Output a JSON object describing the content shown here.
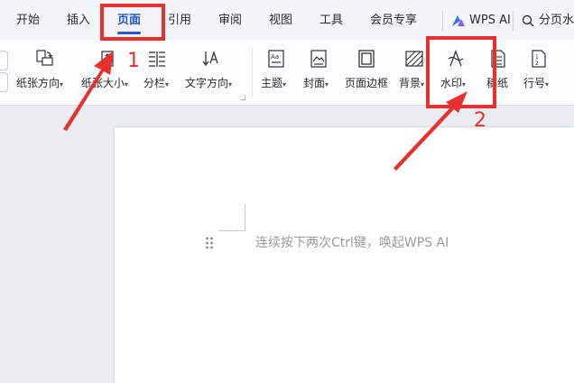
{
  "tabs": [
    {
      "label": "开始"
    },
    {
      "label": "插入"
    },
    {
      "label": "页面"
    },
    {
      "label": "引用"
    },
    {
      "label": "审阅"
    },
    {
      "label": "视图"
    },
    {
      "label": "工具"
    },
    {
      "label": "会员专享"
    }
  ],
  "active_tab": "页面",
  "wps_ai_label": "WPS AI",
  "search_label": "分页水印",
  "ribbon": {
    "paper_direction": "纸张方向",
    "paper_size": "纸张大小",
    "columns": "分栏",
    "text_direction": "文字方向",
    "theme": "主题",
    "cover": "封面",
    "page_border": "页面边框",
    "background": "背景",
    "watermark": "水印",
    "manuscript": "稿纸",
    "line_number": "行号"
  },
  "document": {
    "placeholder": "连续按下两次Ctrl键，唤起WPS AI"
  },
  "annotations": {
    "step1": "1",
    "step2": "2"
  },
  "colors": {
    "accent": "#2456d9",
    "highlight_red": "#e8302f"
  }
}
